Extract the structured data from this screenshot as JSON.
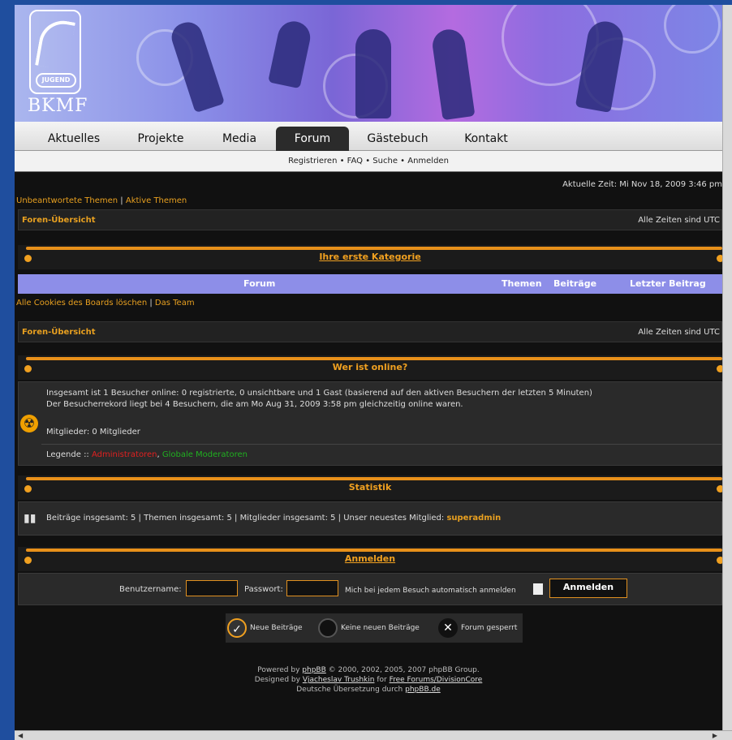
{
  "header": {
    "brand": "BKMF",
    "logo_badge": "JUGEND"
  },
  "nav": {
    "tabs": [
      "Aktuelles",
      "Projekte",
      "Media",
      "Forum",
      "Gästebuch",
      "Kontakt"
    ],
    "active": "Forum"
  },
  "subnav": {
    "links": "Registrieren • FAQ • Suche • Anmelden"
  },
  "time_info": "Aktuelle Zeit: Mi Nov 18, 2009 3:46 pm",
  "quick_links": {
    "unanswered": "Unbeantwortete Themen",
    "separator": "|",
    "active": "Aktive Themen"
  },
  "breadcrumb": {
    "label": "Foren-Übersicht",
    "timezone": "Alle Zeiten sind UTC"
  },
  "category": {
    "title": "Ihre erste Kategorie",
    "columns": {
      "forum": "Forum",
      "topics": "Themen",
      "posts": "Beiträge",
      "last_post": "Letzter Beitrag"
    }
  },
  "board_links": {
    "delete_cookies": "Alle Cookies des Boards löschen",
    "separator": "|",
    "team": "Das Team"
  },
  "breadcrumb2": {
    "label": "Foren-Übersicht",
    "timezone": "Alle Zeiten sind UTC"
  },
  "online": {
    "title": "Wer ist online?",
    "line1": "Insgesamt ist 1 Besucher online: 0 registrierte, 0 unsichtbare und 1 Gast (basierend auf den aktiven Besuchern der letzten 5 Minuten)",
    "line2": "Der Besucherrekord liegt bei 4 Besuchern, die am Mo Aug 31, 2009 3:58 pm gleichzeitig online waren.",
    "members": "Mitglieder: 0 Mitglieder",
    "legend_label": "Legende ::",
    "legend_admin": "Administratoren",
    "legend_sep": ",",
    "legend_mods": "Globale Moderatoren",
    "admin_color": "#e02020",
    "mod_color": "#20b020"
  },
  "stats": {
    "title": "Statistik",
    "text": "Beiträge insgesamt: 5 | Themen insgesamt: 5 | Mitglieder insgesamt: 5 | Unser neuestes Mitglied:",
    "newest_member": "superadmin"
  },
  "login": {
    "title": "Anmelden",
    "username_label": "Benutzername:",
    "password_label": "Passwort:",
    "autologin_label": "Mich bei jedem Besuch automatisch anmelden",
    "button": "Anmelden"
  },
  "legend": {
    "new_posts": "Neue Beiträge",
    "no_new_posts": "Keine neuen Beiträge",
    "locked": "Forum gesperrt"
  },
  "footer": {
    "line1_prefix": "Powered by",
    "line1_link": "phpBB",
    "line1_suffix": "© 2000, 2002, 2005, 2007 phpBB Group.",
    "line2_prefix": "Designed by",
    "line2_link": "Vjacheslav Trushkin",
    "line2_mid": "for",
    "line2_link2": "Free Forums/DivisionCore",
    "line3_prefix": "Deutsche Übersetzung durch",
    "line3_link": "phpBB.de"
  },
  "colors": {
    "accent": "#e8a020",
    "nav_active": "#2b2b2b",
    "forum_header": "#8d8ee8"
  }
}
